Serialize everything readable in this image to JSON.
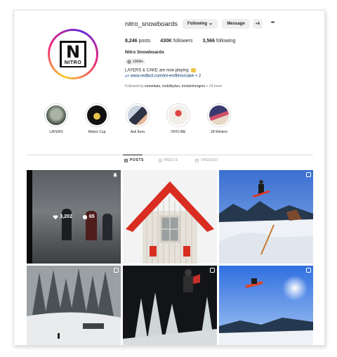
{
  "profile": {
    "username": "nitro_snowboards",
    "following_label": "Following",
    "message_label": "Message",
    "add_user_label": "+A",
    "more_label": "•••",
    "posts_count": "8,246",
    "posts_label": "posts",
    "followers_count": "430K",
    "followers_label": "followers",
    "following_count": "3,566",
    "following_stat_label": "following",
    "full_name": "Nitro Snowboards",
    "threads_badge": "100M+",
    "bio": "LAYERS & CAKE are now playing",
    "link": "www.redbull.com/int-en/films/cake + 2",
    "followed_by_prefix": "Followed by",
    "followed_by_names": "eemettala, mobilityduo, torsteinhorgmo",
    "followed_by_suffix": "+ 24 more",
    "logo_letter": "N",
    "logo_word": "NITRO"
  },
  "highlights": [
    {
      "label": "LAYERS",
      "color": "#7a8a78"
    },
    {
      "label": "Riders Cup",
      "color": "#1b1b1b"
    },
    {
      "label": "Ask Eero",
      "color": "#4a5c7a"
    },
    {
      "label": "OFFLINE",
      "color": "#d94444"
    },
    {
      "label": "28 Winters",
      "color": "#5b4e8a"
    }
  ],
  "tabs": [
    {
      "label": "POSTS",
      "active": true
    },
    {
      "label": "REELS",
      "active": false
    },
    {
      "label": "TAGGED",
      "active": false
    }
  ],
  "posts": [
    {
      "likes": "3,202",
      "comments": "65",
      "pinned": true
    },
    {},
    {},
    {},
    {},
    {}
  ],
  "icons": [
    "threads-icon",
    "link-icon",
    "posts-grid-icon",
    "reels-icon",
    "tagged-icon",
    "heart-icon",
    "comment-icon",
    "pin-icon",
    "reel-badge-icon",
    "chevron-down-icon"
  ]
}
